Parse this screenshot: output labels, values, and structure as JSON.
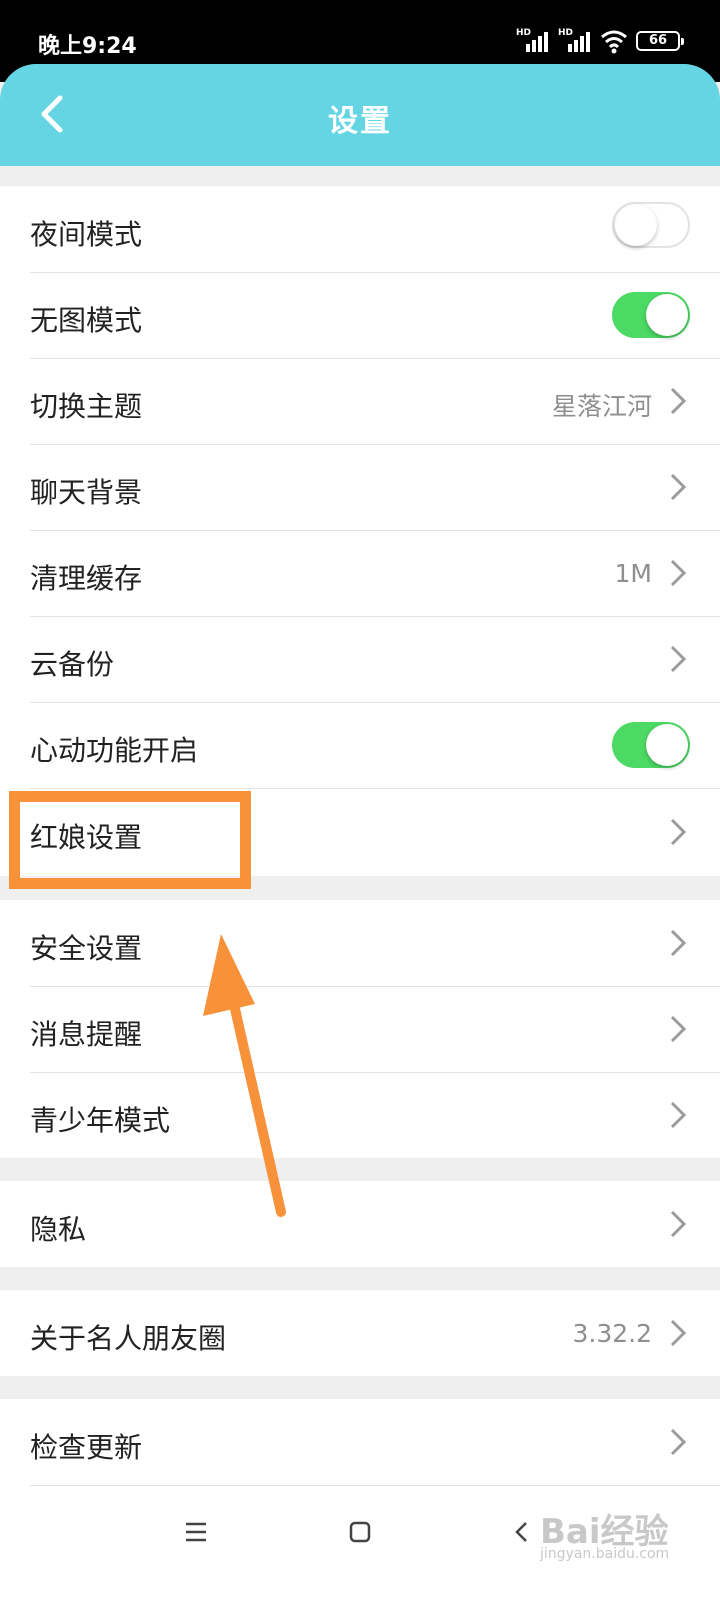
{
  "status_bar": {
    "time": "晚上9:24",
    "signal_label": "HD",
    "battery": "66"
  },
  "header": {
    "title": "设置",
    "back_icon": "chevron-left-icon",
    "background": "#66d5e3"
  },
  "groups": [
    {
      "items": [
        {
          "label": "夜间模式",
          "control": "toggle",
          "on": false
        },
        {
          "label": "无图模式",
          "control": "toggle",
          "on": true
        },
        {
          "label": "切换主题",
          "value": "星落江河",
          "control": "chevron"
        },
        {
          "label": "聊天背景",
          "control": "chevron"
        },
        {
          "label": "清理缓存",
          "value": "1M",
          "control": "chevron"
        },
        {
          "label": "云备份",
          "control": "chevron"
        },
        {
          "label": "心动功能开启",
          "control": "toggle",
          "on": true
        },
        {
          "label": "红娘设置",
          "control": "chevron",
          "highlighted": true
        }
      ]
    },
    {
      "items": [
        {
          "label": "安全设置",
          "control": "chevron"
        },
        {
          "label": "消息提醒",
          "control": "chevron"
        },
        {
          "label": "青少年模式",
          "control": "chevron"
        }
      ]
    },
    {
      "items": [
        {
          "label": "隐私",
          "control": "chevron"
        }
      ]
    },
    {
      "items": [
        {
          "label": "关于名人朋友圈",
          "value": "3.32.2",
          "control": "chevron"
        }
      ]
    },
    {
      "items": [
        {
          "label": "检查更新",
          "control": "chevron"
        }
      ]
    }
  ],
  "colors": {
    "toggle_on": "#4cd964",
    "highlight": "#f7923a"
  },
  "nav_bar": {
    "menu_icon": "menu-icon",
    "home_icon": "home-square-icon",
    "back_icon": "back-triangle-icon"
  },
  "watermark": {
    "text": "Bai经验",
    "url": "jingyan.baidu.com"
  }
}
